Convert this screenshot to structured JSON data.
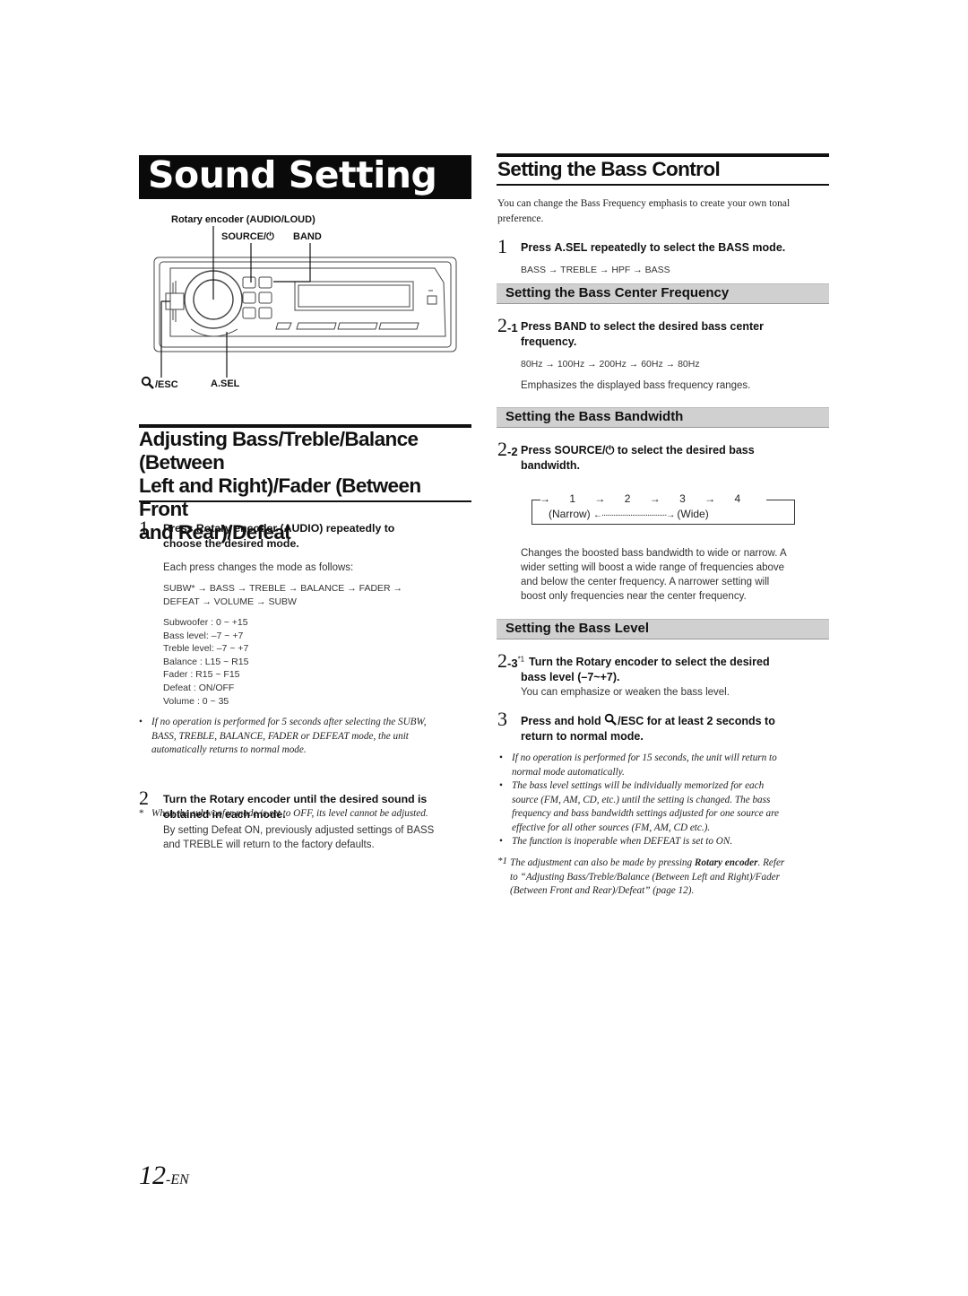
{
  "left": {
    "title": "Sound Setting",
    "diagram": {
      "labels": {
        "rotary": "Rotary encoder (AUDIO/LOUD)",
        "source": "SOURCE/⏻",
        "band": "BAND",
        "esc": "/ESC",
        "asel": "A.SEL"
      }
    },
    "section_heading_lines": [
      "Adjusting Bass/Treble/Balance (Between",
      "Left and Right)/Fader (Between Front",
      "and Rear)/Defeat"
    ],
    "step1": {
      "num": "1",
      "pre": "Press ",
      "bold": "Rotary encoder (AUDIO)",
      "post": " repeatedly to",
      "line2": "choose the desired mode.",
      "desc": "Each press changes the mode as follows:",
      "sequence_line1": "SUBW* → BASS → TREBLE → BALANCE → FADER →",
      "sequence_line2": "DEFEAT → VOLUME → SUBW",
      "ranges": [
        "Subwoofer : 0 ~ +15",
        "Bass level: –7 ~ +7",
        "Treble level: –7 ~ +7",
        "Balance : L15 ~ R15",
        "Fader : R15 ~ F15",
        "Defeat : ON/OFF",
        "Volume : 0 ~ 35"
      ]
    },
    "note_bullet": {
      "mark": "•",
      "lines": [
        "If no operation is performed for 5 seconds after selecting the SUBW,",
        "BASS, TREBLE, BALANCE, FADER or DEFEAT mode, the unit",
        "automatically returns to normal mode."
      ]
    },
    "note_star": {
      "mark": "*",
      "text": "When the subwoofer mode is set to OFF, its level cannot be adjusted."
    },
    "step2": {
      "num": "2",
      "pre": "Turn the ",
      "bold": "Rotary encoder",
      "post": " until the desired sound is",
      "line2": "obtained in each mode.",
      "desc_lines": [
        "By setting Defeat ON, previously adjusted settings of BASS",
        "and TREBLE will return to the factory defaults."
      ]
    },
    "page_number": "12",
    "page_suffix": "-EN"
  },
  "right": {
    "heading": "Setting the Bass Control",
    "intro_lines": [
      "You can change the Bass Frequency emphasis to create your own tonal",
      "preference."
    ],
    "step1": {
      "num": "1",
      "pre": "Press ",
      "bold": "A.SEL",
      "post": " repeatedly to select the BASS mode.",
      "sequence": "BASS → TREBLE → HPF → BASS"
    },
    "sub1": {
      "heading": "Setting the Bass Center Frequency",
      "step_num": "2",
      "step_sub": "-1",
      "pre": "Press ",
      "bold": "BAND",
      "post": " to select the desired bass center",
      "line2": "frequency.",
      "sequence": "80Hz → 100Hz → 200Hz → 60Hz → 80Hz",
      "desc": "Emphasizes the displayed bass frequency ranges."
    },
    "sub2": {
      "heading": "Setting the Bass Bandwidth",
      "step_num": "2",
      "step_sub": "-2",
      "pre": "Press ",
      "bold": "SOURCE/⏻",
      "post": " to select the desired bass",
      "line2": "bandwidth.",
      "cycle": {
        "values": [
          "1",
          "2",
          "3",
          "4"
        ],
        "arrow": "→",
        "narrow": "(Narrow)",
        "wide": "(Wide)",
        "dots": "←··································→"
      },
      "desc_lines": [
        "Changes the boosted bass bandwidth to wide or narrow. A",
        "wider setting will boost a wide range of frequencies above",
        "and below the center frequency. A narrower setting will",
        "boost only frequencies near the center frequency."
      ]
    },
    "sub3": {
      "heading": "Setting the Bass Level",
      "step_num": "2",
      "step_sub": "-3",
      "footnote_ref": "*1",
      "pre": "Turn the ",
      "bold": "Rotary encoder",
      "post": " to select the desired",
      "line2": "bass level (–7~+7).",
      "desc": "You can emphasize or weaken the bass level."
    },
    "step3": {
      "num": "3",
      "pre": "Press and hold ",
      "bold": "/ESC",
      "post": " for at least 2 seconds to",
      "line2": "return to normal mode."
    },
    "notes": [
      {
        "mark": "•",
        "lines": [
          "If no operation is performed for 15 seconds, the unit will return to",
          "normal mode automatically."
        ]
      },
      {
        "mark": "•",
        "lines": [
          "The bass level settings will be individually memorized for each",
          "source (FM, AM, CD, etc.) until the setting is changed. The bass",
          "frequency and bass bandwidth settings adjusted for one source are",
          "effective for all other sources (FM, AM, CD etc.)."
        ]
      },
      {
        "mark": "•",
        "lines": [
          "The function is inoperable when DEFEAT is set to ON."
        ]
      }
    ],
    "footnote": {
      "mark": "*1",
      "pre": "The adjustment can also be made by pressing ",
      "bold": "Rotary encoder",
      "post": ". Refer",
      "line2": "to “Adjusting Bass/Treble/Balance (Between Left and Right)/Fader",
      "line3": "(Between Front and Rear)/Defeat” (page 12)."
    }
  }
}
